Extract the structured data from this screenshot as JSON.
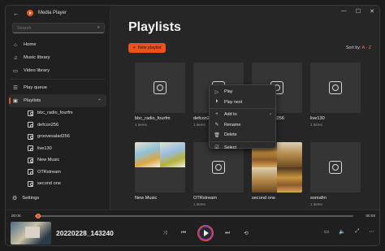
{
  "app": {
    "title": "Media Player"
  },
  "titlebar": {
    "minimize": "—",
    "maximize": "☐",
    "close": "✕"
  },
  "search": {
    "placeholder": "Search"
  },
  "nav": {
    "home": "Home",
    "music_library": "Music library",
    "video_library": "Video library",
    "play_queue": "Play queue",
    "playlists": "Playlists",
    "playlist_items": [
      "bbc_radio_fourfm",
      "defcon256",
      "groovesalad256",
      "live130",
      "New Music",
      "OTRstream",
      "second one"
    ],
    "settings": "Settings"
  },
  "main": {
    "title": "Playlists",
    "new_playlist": "New playlist",
    "sort_label": "Sort by:",
    "sort_value": "A - Z"
  },
  "playlists": [
    {
      "name": "bbc_radio_fourfm",
      "count": "1 items"
    },
    {
      "name": "defcon256",
      "count": "1 items"
    },
    {
      "name": "groovesalad256",
      "count": "1 items"
    },
    {
      "name": "live130",
      "count": "1 items"
    },
    {
      "name": "New Music",
      "count": ""
    },
    {
      "name": "OTRstream",
      "count": "1 items"
    },
    {
      "name": "second one",
      "count": ""
    },
    {
      "name": "somafm",
      "count": "1 items"
    }
  ],
  "context_menu": {
    "play": "Play",
    "play_next": "Play next",
    "add_to": "Add to",
    "rename": "Rename",
    "delete": "Delete",
    "select": "Select"
  },
  "player": {
    "current_time": "00:00",
    "total_time": "00:00",
    "progress": 0.01,
    "now_playing": "20220228_143240"
  },
  "colors": {
    "accent": "#e8531b",
    "background": "#262626"
  }
}
